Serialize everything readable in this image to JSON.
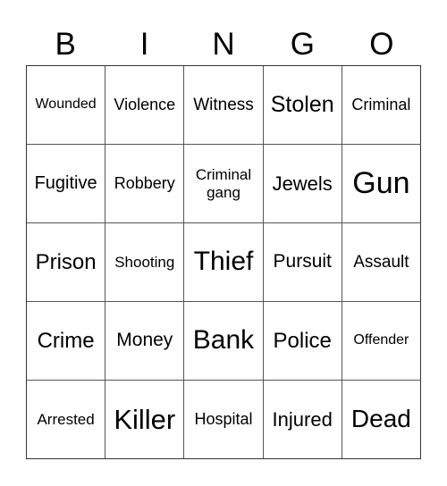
{
  "header": [
    "B",
    "I",
    "N",
    "G",
    "O"
  ],
  "cells": [
    "Wounded",
    "Violence",
    "Witness",
    "Stolen",
    "Criminal",
    "Fugitive",
    "Robbery",
    "Criminal gang",
    "Jewels",
    "Gun",
    "Prison",
    "Shooting",
    "Thief",
    "Pursuit",
    "Assault",
    "Crime",
    "Money",
    "Bank",
    "Police",
    "Offender",
    "Arrested",
    "Killer",
    "Hospital",
    "Injured",
    "Dead"
  ]
}
